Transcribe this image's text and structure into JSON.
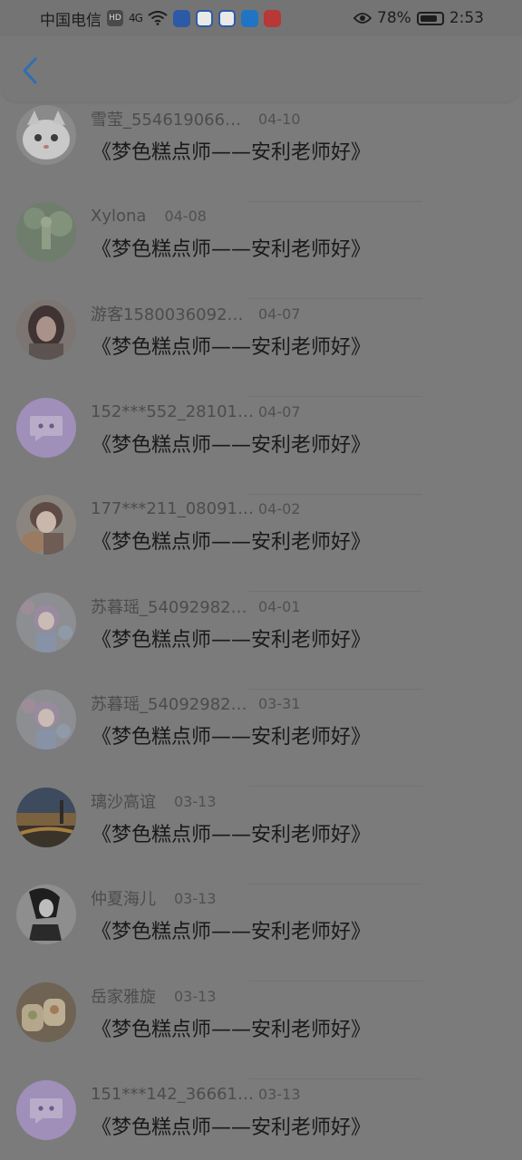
{
  "status_bar": {
    "carrier": "中国电信",
    "hd_badge": "HD",
    "network": "4G",
    "battery": "78%",
    "time": "2:53",
    "icons": [
      "wifi-icon",
      "music-app-icon",
      "baidu-app-icon",
      "baidu-app-icon",
      "weather-app-icon",
      "reader-app-icon",
      "eye-icon",
      "battery-icon"
    ]
  },
  "header": {
    "back_icon": "chevron-left-icon"
  },
  "accent_color": "#2d6fb3",
  "items": [
    {
      "name": "雪莹_554619066…",
      "date": "04-10",
      "message": "《梦色糕点师——安利老师好》",
      "avatar": "white-kitten-avatar"
    },
    {
      "name": "Xylona",
      "date": "04-08",
      "message": "《梦色糕点师——安利老师好》",
      "avatar": "green-garden-avatar"
    },
    {
      "name": "游客1580036092…",
      "date": "04-07",
      "message": "《梦色糕点师——安利老师好》",
      "avatar": "girl-photo-avatar"
    },
    {
      "name": "152***552_28101…",
      "date": "04-07",
      "message": "《梦色糕点师——安利老师好》",
      "avatar": "default-chat-avatar"
    },
    {
      "name": "177***211_08091…",
      "date": "04-02",
      "message": "《梦色糕点师——安利老师好》",
      "avatar": "anime-girl-bear-avatar"
    },
    {
      "name": "苏暮瑶_54092982…",
      "date": "04-01",
      "message": "《梦色糕点师——安利老师好》",
      "avatar": "anime-girl-flowers-avatar"
    },
    {
      "name": "苏暮瑶_54092982…",
      "date": "03-31",
      "message": "《梦色糕点师——安利老师好》",
      "avatar": "anime-girl-flowers-avatar"
    },
    {
      "name": "璃沙高谊",
      "date": "03-13",
      "message": "《梦色糕点师——安利老师好》",
      "avatar": "sunset-road-avatar"
    },
    {
      "name": "仲夏海儿",
      "date": "03-13",
      "message": "《梦色糕点师——安利老师好》",
      "avatar": "dark-anime-avatar"
    },
    {
      "name": "岳家雅旋",
      "date": "03-13",
      "message": "《梦色糕点师——安利老师好》",
      "avatar": "food-rolls-avatar"
    },
    {
      "name": "151***142_36661…",
      "date": "03-13",
      "message": "《梦色糕点师——安利老师好》",
      "avatar": "default-chat-avatar"
    }
  ]
}
